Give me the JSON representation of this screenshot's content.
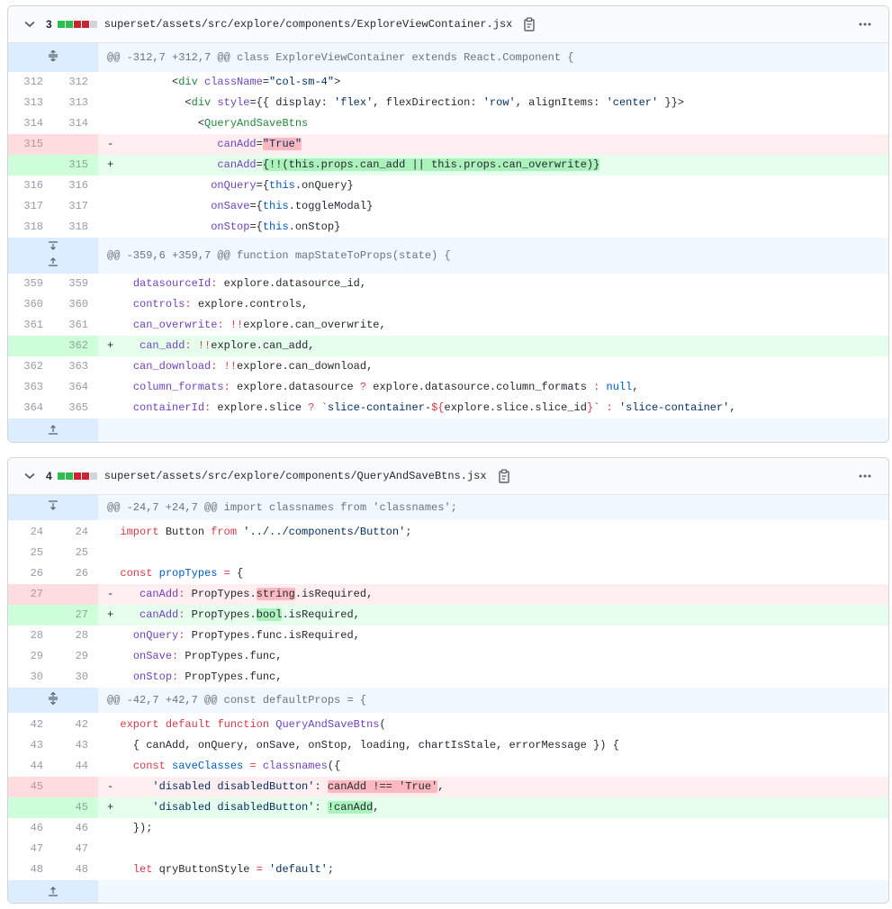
{
  "files": [
    {
      "changes": "3",
      "filename": "superset/assets/src/explore/components/ExploreViewContainer.jsx",
      "diffstat_colors": [
        "#2cbe4e",
        "#2cbe4e",
        "#cb2431",
        "#cb2431",
        "#d1d5da"
      ],
      "hunks": [
        {
          "header": "@@ -312,7 +312,7 @@ class ExploreViewContainer extends React.Component {"
        },
        {
          "header": "@@ -359,6 +359,7 @@ function mapStateToProps(state) {"
        }
      ]
    },
    {
      "changes": "4",
      "filename": "superset/assets/src/explore/components/QueryAndSaveBtns.jsx",
      "diffstat_colors": [
        "#2cbe4e",
        "#2cbe4e",
        "#cb2431",
        "#cb2431",
        "#d1d5da"
      ],
      "hunks": [
        {
          "header": "@@ -24,7 +24,7 @@ import classnames from 'classnames';"
        },
        {
          "header": "@@ -42,7 +42,7 @@ const defaultProps = {"
        }
      ]
    }
  ],
  "lines": {
    "f0_312": {
      "old": "312",
      "new": "312"
    },
    "f0_313": {
      "old": "313",
      "new": "313"
    },
    "f0_314": {
      "old": "314",
      "new": "314"
    },
    "f0_315d": {
      "old": "315",
      "new": "",
      "sign": "-"
    },
    "f0_315a": {
      "old": "",
      "new": "315",
      "sign": "+"
    },
    "f0_316": {
      "old": "316",
      "new": "316"
    },
    "f0_317": {
      "old": "317",
      "new": "317"
    },
    "f0_318": {
      "old": "318",
      "new": "318"
    },
    "f0_359": {
      "old": "359",
      "new": "359"
    },
    "f0_360": {
      "old": "360",
      "new": "360"
    },
    "f0_361": {
      "old": "361",
      "new": "361"
    },
    "f0_362a": {
      "old": "",
      "new": "362",
      "sign": "+"
    },
    "f0_362": {
      "old": "362",
      "new": "363"
    },
    "f0_363": {
      "old": "363",
      "new": "364"
    },
    "f0_364": {
      "old": "364",
      "new": "365"
    },
    "f1_24": {
      "old": "24",
      "new": "24"
    },
    "f1_25": {
      "old": "25",
      "new": "25"
    },
    "f1_26": {
      "old": "26",
      "new": "26"
    },
    "f1_27d": {
      "old": "27",
      "new": "",
      "sign": "-"
    },
    "f1_27a": {
      "old": "",
      "new": "27",
      "sign": "+"
    },
    "f1_28": {
      "old": "28",
      "new": "28"
    },
    "f1_29": {
      "old": "29",
      "new": "29"
    },
    "f1_30": {
      "old": "30",
      "new": "30"
    },
    "f1_42": {
      "old": "42",
      "new": "42"
    },
    "f1_43": {
      "old": "43",
      "new": "43"
    },
    "f1_44": {
      "old": "44",
      "new": "44"
    },
    "f1_45d": {
      "old": "45",
      "new": "",
      "sign": "-"
    },
    "f1_45a": {
      "old": "",
      "new": "45",
      "sign": "+"
    },
    "f1_46": {
      "old": "46",
      "new": "46"
    },
    "f1_47": {
      "old": "47",
      "new": "47"
    },
    "f1_48": {
      "old": "48",
      "new": "48"
    }
  },
  "code": {
    "l312": [
      "          <",
      "div",
      " ",
      "className",
      "=",
      "\"col-sm-4\"",
      ">"
    ],
    "l313": [
      "            <",
      "div",
      " ",
      "style",
      "=",
      "{{ display: ",
      "'flex'",
      ", flexDirection: ",
      "'row'",
      ", alignItems: ",
      "'center'",
      " }}>"
    ],
    "l314": [
      "              <",
      "QueryAndSaveBtns"
    ],
    "l315d": [
      "                ",
      "canAdd",
      "=",
      "\"True\""
    ],
    "l315a": [
      "                ",
      "canAdd",
      "=",
      "{!!(this.props.can_add || this.props.can_overwrite)}"
    ],
    "l316": [
      "                ",
      "onQuery",
      "=",
      "{",
      "this",
      ".onQuery}"
    ],
    "l317": [
      "                ",
      "onSave",
      "=",
      "{",
      "this",
      ".toggleModal}"
    ],
    "l318": [
      "                ",
      "onStop",
      "=",
      "{",
      "this",
      ".onStop}"
    ],
    "l359": [
      "    ",
      "datasourceId",
      ":",
      " explore.datasource_id,"
    ],
    "l360": [
      "    ",
      "controls",
      ":",
      " explore.controls,"
    ],
    "l361": [
      "    ",
      "can_overwrite",
      ":",
      " ",
      "!!",
      "explore.can_overwrite,"
    ],
    "l362a": [
      "    ",
      "can_add",
      ":",
      " ",
      "!!",
      "explore.can_add,"
    ],
    "l362": [
      "    ",
      "can_download",
      ":",
      " ",
      "!!",
      "explore.can_download,"
    ],
    "l363": [
      "    ",
      "column_formats",
      ":",
      " explore.datasource ",
      "?",
      " explore.datasource.column_formats ",
      ":",
      " ",
      "null",
      ","
    ],
    "l364": [
      "    ",
      "containerId",
      ":",
      " explore.slice ",
      "?",
      " ",
      "`slice-container-",
      "${",
      "explore.slice.slice_id",
      "}",
      "`",
      " ",
      ":",
      " ",
      "'slice-container'",
      ","
    ],
    "l24": [
      "  ",
      "import",
      " Button ",
      "from",
      " ",
      "'../../components/Button'",
      ";"
    ],
    "l25": [
      ""
    ],
    "l26": [
      "  ",
      "const",
      " ",
      "propTypes",
      " ",
      "=",
      " {"
    ],
    "l27d": [
      "    ",
      "canAdd",
      ":",
      " PropTypes.",
      "string",
      ".isRequired,"
    ],
    "l27a": [
      "    ",
      "canAdd",
      ":",
      " PropTypes.",
      "bool",
      ".isRequired,"
    ],
    "l28": [
      "    ",
      "onQuery",
      ":",
      " PropTypes.func.isRequired,"
    ],
    "l29": [
      "    ",
      "onSave",
      ":",
      " PropTypes.func,"
    ],
    "l30": [
      "    ",
      "onStop",
      ":",
      " PropTypes.func,"
    ],
    "l42": [
      "  ",
      "export",
      " ",
      "default",
      " ",
      "function",
      " ",
      "QueryAndSaveBtns",
      "("
    ],
    "l43": [
      "    { canAdd, onQuery, onSave, onStop, loading, chartIsStale, errorMessage }) {"
    ],
    "l44": [
      "    ",
      "const",
      " ",
      "saveClasses",
      " ",
      "=",
      " ",
      "classnames",
      "({"
    ],
    "l45d": [
      "      ",
      "'disabled disabledButton'",
      ": ",
      "canAdd !== 'True'",
      ","
    ],
    "l45a": [
      "      ",
      "'disabled disabledButton'",
      ": ",
      "!canAdd",
      ","
    ],
    "l46": [
      "    });"
    ],
    "l47": [
      ""
    ],
    "l48": [
      "    ",
      "let",
      " qryButtonStyle ",
      "=",
      " ",
      "'default'",
      ";"
    ]
  },
  "icons": {
    "chevron": "chevron-down-icon",
    "clipboard": "clipboard-icon",
    "kebab": "kebab-horizontal-icon",
    "expand": "unfold-icon",
    "expand_up": "fold-up-icon",
    "expand_down": "fold-down-icon"
  }
}
